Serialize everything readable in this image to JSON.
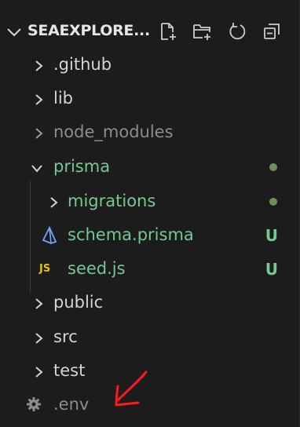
{
  "explorer": {
    "title": "SEAEXPLORE...",
    "actions": [
      "new-file-icon",
      "new-folder-icon",
      "refresh-icon",
      "collapse-all-icon"
    ]
  },
  "tree": [
    {
      "label": ".github",
      "kind": "folder",
      "expanded": false,
      "state": "normal"
    },
    {
      "label": "lib",
      "kind": "folder",
      "expanded": false,
      "state": "normal"
    },
    {
      "label": "node_modules",
      "kind": "folder",
      "expanded": false,
      "state": "ignored"
    },
    {
      "label": "prisma",
      "kind": "folder",
      "expanded": true,
      "state": "untracked",
      "decoration": "dot"
    },
    {
      "label": "migrations",
      "kind": "folder",
      "expanded": false,
      "state": "untracked",
      "decoration": "dot"
    },
    {
      "label": "schema.prisma",
      "kind": "file",
      "icon": "prisma-icon",
      "state": "untracked",
      "decoration": "U"
    },
    {
      "label": "seed.js",
      "kind": "file",
      "icon": "js-icon",
      "icon_text": "JS",
      "state": "untracked",
      "decoration": "U"
    },
    {
      "label": "public",
      "kind": "folder",
      "expanded": false,
      "state": "normal"
    },
    {
      "label": "src",
      "kind": "folder",
      "expanded": false,
      "state": "normal"
    },
    {
      "label": "test",
      "kind": "folder",
      "expanded": false,
      "state": "normal"
    },
    {
      "label": ".env",
      "kind": "file",
      "icon": "gear-icon",
      "state": "ignored"
    }
  ],
  "colors": {
    "background": "#1c1c1c",
    "text": "#d4d4d4",
    "ignored": "#8c8c8c",
    "untracked": "#73c991",
    "dot": "#6e8f57",
    "annotation": "#ff1a1a",
    "js_badge": "#e5c100"
  }
}
